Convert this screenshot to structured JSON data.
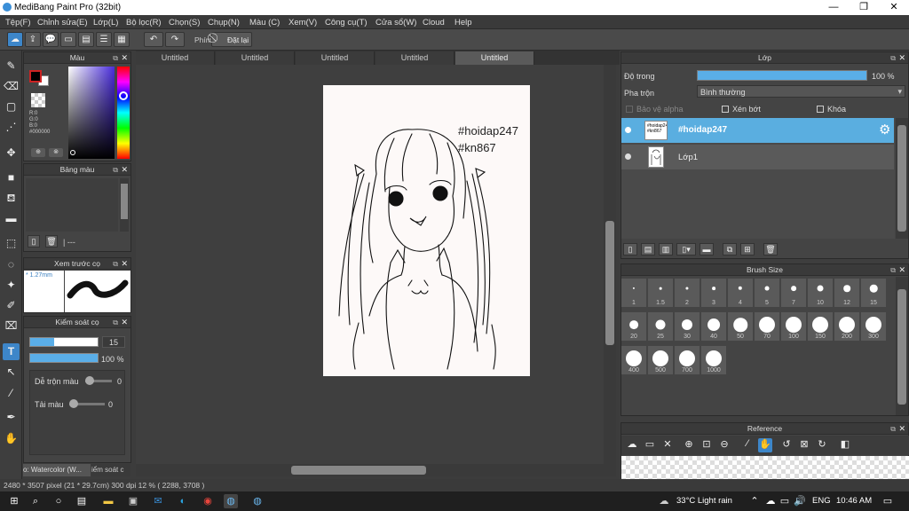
{
  "window": {
    "title": "MediBang Paint Pro (32bit)",
    "minimize": "—",
    "maximize": "❐",
    "close": "✕"
  },
  "menu": [
    "Tệp(F)",
    "Chỉnh sửa(E)",
    "Lớp(L)",
    "Bộ lọc(R)",
    "Chọn(S)",
    "Chụp(N)",
    "Màu (C)",
    "Xem(V)",
    "Công cụ(T)",
    "Cửa sổ(W)",
    "Cloud",
    "Help"
  ],
  "toolbar": {
    "phim_label": "Phím",
    "reset_label": "Đặt lại"
  },
  "color_panel": {
    "title": "Màu",
    "r": "R:0",
    "g": "G:0",
    "b": "B:0",
    "hex": "#000000",
    "primary": "#000000",
    "secondary": "#ffffff"
  },
  "palette_panel": {
    "title": "Bảng màu",
    "separator": "| ---"
  },
  "brush_preview_panel": {
    "title": "Xem trước cọ",
    "size": "* 1.27mm"
  },
  "brush_control_panel": {
    "title": "Kiểm soát cọ",
    "size_value": "15",
    "opacity_value": "100 %",
    "size_fraction": 0.35,
    "opacity_fraction": 1.0
  },
  "brush_settings": {
    "blend_label": "Dễ trộn màu",
    "blend_value": "0",
    "reload_label": "Tải màu",
    "reload_value": "0"
  },
  "bottom_tabs": {
    "left": "o: Watercolor (W...",
    "right": "iểm soát c"
  },
  "tabs": [
    "Untitled",
    "Untitled",
    "Untitled",
    "Untitled",
    "Untitled"
  ],
  "active_tab": 4,
  "canvas_text": {
    "line1": "#hoidap247",
    "line2": "#kn867"
  },
  "layer_panel": {
    "title": "Lớp",
    "opacity_label": "Độ trong",
    "opacity_value": "100 %",
    "opacity_fraction": 1.0,
    "blend_label": "Pha trộn",
    "blend_value": "Bình thường",
    "protect_alpha": "Bảo vệ alpha",
    "clipping": "Xén bớt",
    "lock": "Khóa",
    "layers": [
      {
        "name": "#hoidap247",
        "thumb": "#hoidap247 #kn867",
        "selected": true
      },
      {
        "name": "Lớp1",
        "thumb": "",
        "selected": false
      }
    ]
  },
  "brush_size_panel": {
    "title": "Brush Size",
    "sizes": [
      "1",
      "1.5",
      "2",
      "3",
      "4",
      "5",
      "7",
      "10",
      "12",
      "15",
      "20",
      "25",
      "30",
      "40",
      "50",
      "70",
      "100",
      "150",
      "200",
      "300",
      "400",
      "500",
      "700",
      "1000"
    ]
  },
  "reference_panel": {
    "title": "Reference"
  },
  "status": "2480 * 3507 pixel  (21 * 29.7cm)  300 dpi  12 %  ( 2288, 3708 )",
  "taskbar": {
    "weather": "33°C  Light rain",
    "lang": "ENG",
    "time": "10:46 AM"
  }
}
